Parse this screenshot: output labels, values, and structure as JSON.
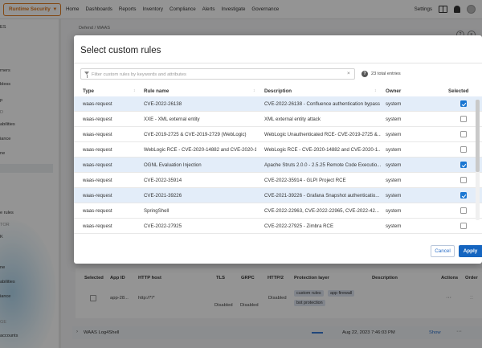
{
  "topnav": {
    "product": "Runtime Security",
    "items": [
      "Home",
      "Dashboards",
      "Reports",
      "Inventory",
      "Compliance",
      "Alerts",
      "Investigate",
      "Governance"
    ],
    "settings": "Settings"
  },
  "sidebar": {
    "items": [
      "ES",
      "rners",
      "bless",
      "p",
      "D",
      "abilities",
      "iance",
      "ne",
      "e rules",
      "TOR",
      "K",
      "ne",
      "abilities",
      "iance",
      "GE",
      "accounts"
    ]
  },
  "background": {
    "breadcrumb": "Defend / WAAS",
    "help_icons": [
      "?",
      "≡"
    ],
    "table": {
      "headers": [
        "Selected",
        "App ID",
        "HTTP host",
        "TLS",
        "GRPC",
        "HTTP/2",
        "Protection layer",
        "Description",
        "Actions",
        "Order"
      ],
      "app_id": "app-28...",
      "http_host": "http://*/*",
      "tls": "Disabled",
      "grpc": "Disabled",
      "http2": "Disabled",
      "tags": [
        "custom rules",
        "app firewall",
        "bot protection"
      ],
      "actions": "···",
      "drag": "::"
    },
    "log_row": {
      "name": "WAAS Log4Shell",
      "date": "Aug 22, 2023 7:46:03 PM",
      "show": "Show",
      "actions": "···"
    }
  },
  "modal": {
    "title": "Select custom rules",
    "filter_placeholder": "Filter custom rules by keywords and attributes",
    "clear": "×",
    "help": "?",
    "total": "23 total entries",
    "columns": [
      "Type",
      "Rule name",
      "Description",
      "Owner",
      "Selected"
    ],
    "rows": [
      {
        "type": "waas-request",
        "name": "CVE-2022-26138",
        "description": "CVE-2022-26138 - Confluence authentication bypass",
        "owner": "system",
        "selected": true
      },
      {
        "type": "waas-request",
        "name": "XXE - XML external entity",
        "description": "XML external entity attack",
        "owner": "system",
        "selected": false
      },
      {
        "type": "waas-request",
        "name": "CVE-2019-2725 & CVE-2019-2729 (WebLogic)",
        "description": "WebLogic Unauthenticated RCE- CVE-2019-2725 &...",
        "owner": "system",
        "selected": false
      },
      {
        "type": "waas-request",
        "name": "WebLogic RCE - CVE-2020-14882 and CVE-2020-1...",
        "description": "WebLogic RCE - CVE-2020-14882 and CVE-2020-1...",
        "owner": "system",
        "selected": false
      },
      {
        "type": "waas-request",
        "name": "OGNL Evaluation Injection",
        "description": "Apache Struts 2.0.0 - 2.5.25 Remote Code Executio...",
        "owner": "system",
        "selected": true
      },
      {
        "type": "waas-request",
        "name": "CVE-2022-35914",
        "description": "CVE-2022-35914 - GLPI Project RCE",
        "owner": "system",
        "selected": false
      },
      {
        "type": "waas-request",
        "name": "CVE-2021-39226",
        "description": "CVE-2021-39226 - Grafana Snapshot authenticatio...",
        "owner": "system",
        "selected": true
      },
      {
        "type": "waas-request",
        "name": "SpringShell",
        "description": "CVE-2022-22963, CVE-2022-22965, CVE-2022-42...",
        "owner": "system",
        "selected": false
      },
      {
        "type": "waas-request",
        "name": "CVE-2022-27925",
        "description": "CVE-2022-27925 - Zimbra RCE",
        "owner": "system",
        "selected": false
      }
    ],
    "cancel": "Cancel",
    "apply": "Apply"
  },
  "colors": {
    "brand": "#e07a1f",
    "primary": "#1565c0",
    "selected_row": "#e3edf9"
  }
}
